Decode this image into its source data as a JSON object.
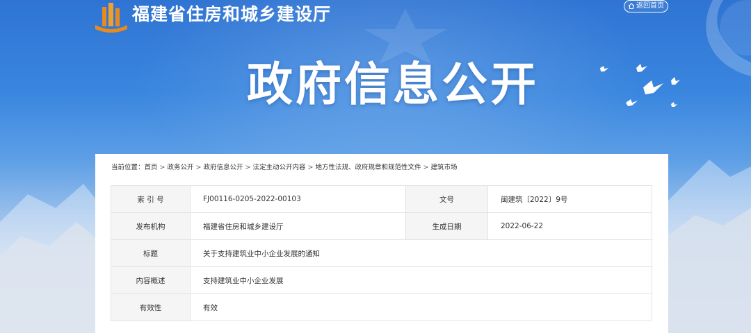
{
  "header": {
    "site_title": "福建省住房和城乡建设厅",
    "home_button_label": "返回首页",
    "home_icon": "home-icon",
    "banner_title": "政府信息公开"
  },
  "breadcrumb": {
    "prefix": "当前位置：",
    "items": [
      "首页",
      "政务公开",
      "政府信息公开",
      "法定主动公开内容",
      "地方性法规、政府规章和规范性文件",
      "建筑市场"
    ],
    "separator": ">"
  },
  "info": {
    "index_label": "索 引 号",
    "index_value": "FJ00116-0205-2022-00103",
    "doc_no_label": "文号",
    "doc_no_value": "闽建筑〔2022〕9号",
    "issuer_label": "发布机构",
    "issuer_value": "福建省住房和城乡建设厅",
    "date_label": "生成日期",
    "date_value": "2022-06-22",
    "title_label": "标题",
    "title_value": "关于支持建筑业中小企业发展的通知",
    "summary_label": "内容概述",
    "summary_value": "支持建筑业中小企业发展",
    "validity_label": "有效性",
    "validity_value": "有效"
  },
  "colors": {
    "banner_top": "#2f74d3",
    "banner_bottom": "#d6e1ee",
    "label_bg": "#f5f5f5",
    "border": "#e3e3e3",
    "logo_orange": "#e98a1c"
  }
}
